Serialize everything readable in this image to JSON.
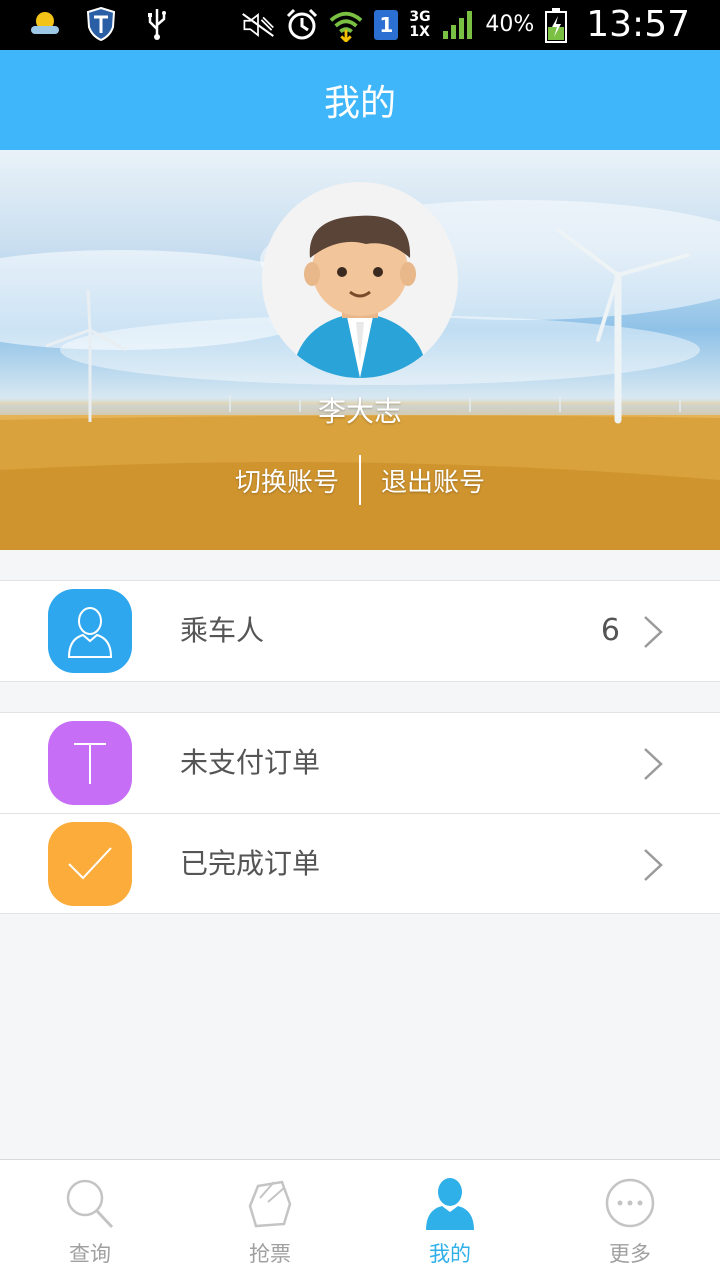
{
  "status_bar": {
    "network_top": "3G",
    "network_bottom": "1X",
    "sim_slot": "1",
    "battery": "40%",
    "time": "13:57"
  },
  "header": {
    "title": "我的"
  },
  "profile": {
    "name": "李大志",
    "switch_account": "切换账号",
    "logout": "退出账号"
  },
  "menu": {
    "passengers": {
      "label": "乘车人",
      "count": "6",
      "icon": "person-icon",
      "color": "#2ea7ef"
    },
    "unpaid": {
      "label": "未支付订单",
      "icon": "letter-t-icon",
      "color": "#c66ef5"
    },
    "completed": {
      "label": "已完成订单",
      "icon": "checkmark-icon",
      "color": "#fbac3a"
    }
  },
  "tabs": [
    {
      "label": "查询",
      "icon": "search-icon"
    },
    {
      "label": "抢票",
      "icon": "ticket-icon"
    },
    {
      "label": "我的",
      "icon": "profile-icon",
      "active": true
    },
    {
      "label": "更多",
      "icon": "more-icon"
    }
  ],
  "colors": {
    "accent": "#3fb6fa",
    "tab_active": "#2fb0e8",
    "tab_inactive": "#a0a0a0"
  }
}
